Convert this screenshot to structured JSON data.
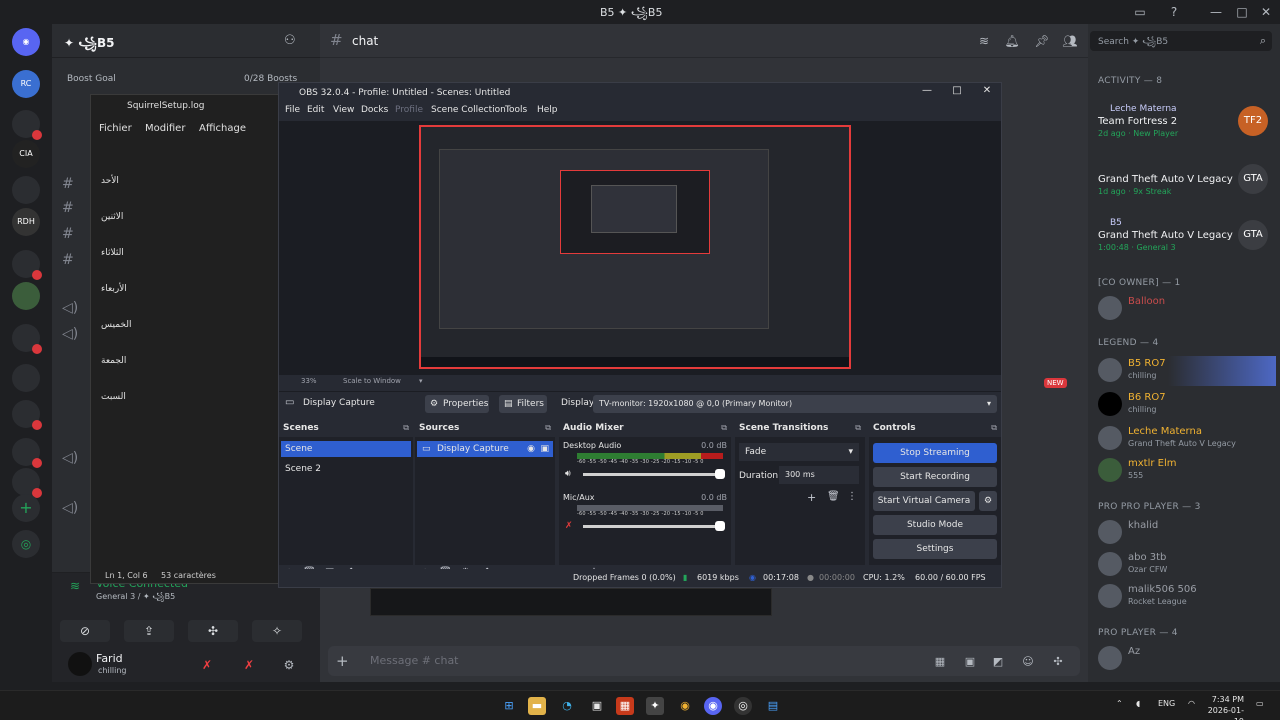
{
  "window_title": "B5 ✦ ꧁B5",
  "guild": {
    "name": "✦ ꧁B5",
    "boost_goal_label": "Boost Goal",
    "boost_count": "0/28 Boosts"
  },
  "servers": [
    "RC",
    "CIA",
    "RDH"
  ],
  "server_badges": [
    "2",
    "3",
    "8",
    "1",
    "54"
  ],
  "voice": {
    "connected_label": "Voice Connected",
    "channel": "General 3 / ✦ ꧁B5"
  },
  "user": {
    "name": "Farid",
    "status": "chilling"
  },
  "chat": {
    "channel_name": "chat",
    "composer_placeholder": "Message # chat"
  },
  "members_panel": {
    "search_placeholder": "Search ✦ ꧁B5",
    "activity_header": "Activity — 8",
    "activities": [
      {
        "user": "Leche Materna",
        "game": "Team Fortress 2",
        "detail": "2d ago · New Player",
        "icon": "TF2"
      },
      {
        "user": "",
        "game": "Grand Theft Auto V Legacy",
        "detail": "1d ago · 9x Streak",
        "icon": "GTA"
      },
      {
        "user": "B5",
        "game": "Grand Theft Auto V Legacy",
        "detail": "1:00:48 · General 3",
        "icon": "GTA"
      }
    ],
    "sections": [
      {
        "title": "[Co OWNER] — 1",
        "members": [
          {
            "name": "Balloon",
            "status": ""
          }
        ]
      },
      {
        "title": "LEGEND — 4",
        "members": [
          {
            "name": "B5 RO7",
            "status": "chilling"
          },
          {
            "name": "B6 RO7",
            "status": "chilling"
          },
          {
            "name": "Leche Materna",
            "status": "Grand Theft Auto V Legacy"
          },
          {
            "name": "mxtlr Elm",
            "status": "555"
          }
        ]
      },
      {
        "title": "PRO PRO PLAYER — 3",
        "members": [
          {
            "name": "khalid",
            "status": ""
          },
          {
            "name": "abo 3tb",
            "status": "Ozar CFW"
          },
          {
            "name": "malik506 506",
            "status": "Rocket League"
          }
        ]
      },
      {
        "title": "PRO PLAYER — 4",
        "members": [
          {
            "name": "Az",
            "status": ""
          }
        ]
      }
    ],
    "new_badge": "NEW"
  },
  "notepad": {
    "title": "SquirrelSetup.log",
    "menu": [
      "Fichier",
      "Modifier",
      "Affichage"
    ],
    "lines": [
      "الأحد",
      "الاثنين",
      "الثلاثاء",
      "الأربعاء",
      "الخميس",
      "الجمعة",
      "السبت"
    ],
    "cursor": "Ln 1, Col 6",
    "chars": "53 caractères"
  },
  "obs": {
    "title": "OBS 32.0.4 - Profile: Untitled - Scenes: Untitled",
    "menu": [
      "File",
      "Edit",
      "View",
      "Docks",
      "Profile",
      "Scene Collection",
      "Tools",
      "Help"
    ],
    "zoom": "33%",
    "scale_mode": "Scale to Window",
    "source_name": "Display Capture",
    "properties_label": "Properties",
    "filters_label": "Filters",
    "display_label": "Display",
    "display_value": "TV-monitor: 1920x1080 @ 0,0 (Primary Monitor)",
    "docks": {
      "scenes": {
        "title": "Scenes",
        "items": [
          "Scene",
          "Scene 2"
        ]
      },
      "sources": {
        "title": "Sources",
        "items": [
          "Display Capture"
        ]
      },
      "mixer": {
        "title": "Audio Mixer",
        "channels": [
          {
            "name": "Desktop Audio",
            "db": "0.0 dB"
          },
          {
            "name": "Mic/Aux",
            "db": "0.0 dB"
          }
        ],
        "scale": "-60 -55 -50 -45 -40 -35 -30 -25 -20 -15 -10 -5 0"
      },
      "transitions": {
        "title": "Scene Transitions",
        "type": "Fade",
        "duration_label": "Duration",
        "duration": "300 ms"
      },
      "controls": {
        "title": "Controls",
        "buttons": [
          "Stop Streaming",
          "Start Recording",
          "Start Virtual Camera",
          "Studio Mode",
          "Settings"
        ]
      }
    },
    "status": {
      "dropped": "Dropped Frames 0 (0.0%)",
      "bitrate": "6019 kbps",
      "stream_time": "00:17:08",
      "rec_time": "00:00:00",
      "cpu": "CPU: 1.2%",
      "fps": "60.00 / 60.00 FPS"
    }
  },
  "taskbar": {
    "lang": "ENG",
    "time": "7:34 PM",
    "date": "2026-01-19"
  },
  "colors": {
    "accent": "#2f5fd0",
    "live": "#e43b3b",
    "online": "#23a55a"
  }
}
